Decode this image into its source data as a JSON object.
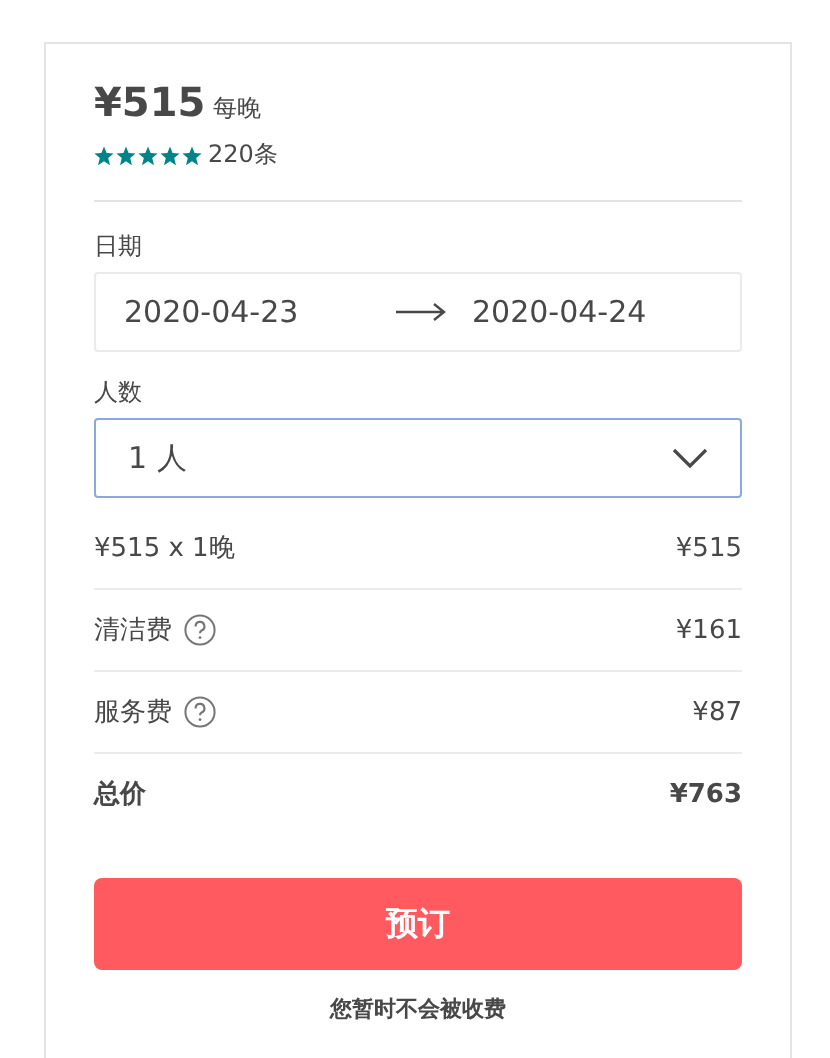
{
  "price": {
    "amount": "¥515",
    "unit": "每晚"
  },
  "rating": {
    "stars": 5,
    "count": "220条"
  },
  "dates": {
    "label": "日期",
    "checkin": "2020-04-23",
    "checkout": "2020-04-24"
  },
  "guests": {
    "label": "人数",
    "value": "1 人"
  },
  "fees": [
    {
      "kind": "plain",
      "label": "¥515 x 1晚",
      "amount": "¥515"
    },
    {
      "kind": "help",
      "label": "清洁费",
      "amount": "¥161"
    },
    {
      "kind": "help",
      "label": "服务费",
      "amount": "¥87"
    },
    {
      "kind": "total",
      "label": "总价",
      "amount": "¥763"
    }
  ],
  "book_button": "预订",
  "note": "您暂时不会被收费"
}
